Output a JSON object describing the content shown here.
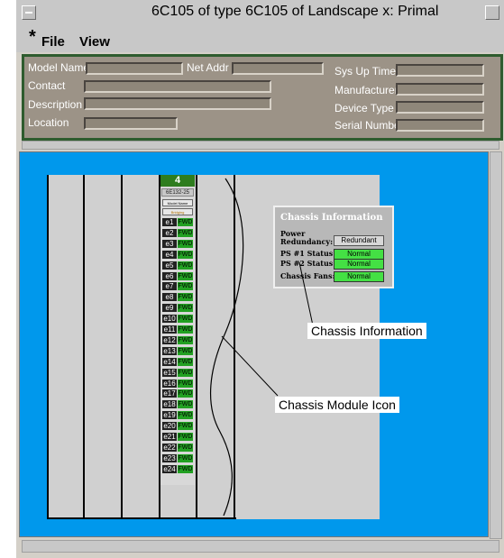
{
  "window": {
    "title": "6C105 of type 6C105 of Landscape x: Primal"
  },
  "menubar": {
    "modified_marker": "*",
    "file": "File",
    "view": "View"
  },
  "device_info": {
    "model_name_label": "Model Name",
    "net_addr_label": "Net Addr",
    "sys_up_time_label": "Sys Up Time",
    "contact_label": "Contact",
    "manufacturer_label": "Manufacturer",
    "description_label": "Description",
    "device_type_label": "Device Type",
    "location_label": "Location",
    "serial_number_label": "Serial Number"
  },
  "module": {
    "slot_number": "4",
    "type": "6E132-25",
    "name": "Model Name",
    "mode": "Bridging",
    "ports": [
      {
        "label": "e1",
        "status": "FWD"
      },
      {
        "label": "e2",
        "status": "FWD"
      },
      {
        "label": "e3",
        "status": "FWD"
      },
      {
        "label": "e4",
        "status": "FWD"
      },
      {
        "label": "e5",
        "status": "FWD"
      },
      {
        "label": "e6",
        "status": "FWD"
      },
      {
        "label": "e7",
        "status": "FWD"
      },
      {
        "label": "e8",
        "status": "FWD"
      },
      {
        "label": "e9",
        "status": "FWD"
      },
      {
        "label": "e10",
        "status": "FWD"
      },
      {
        "label": "e11",
        "status": "FWD"
      },
      {
        "label": "e12",
        "status": "FWD"
      },
      {
        "label": "e13",
        "status": "FWD"
      },
      {
        "label": "e14",
        "status": "FWD"
      },
      {
        "label": "e15",
        "status": "FWD"
      },
      {
        "label": "e16",
        "status": "FWD"
      },
      {
        "label": "e17",
        "status": "FWD"
      },
      {
        "label": "e18",
        "status": "FWD"
      },
      {
        "label": "e19",
        "status": "FWD"
      },
      {
        "label": "e20",
        "status": "FWD"
      },
      {
        "label": "e21",
        "status": "FWD"
      },
      {
        "label": "e22",
        "status": "FWD"
      },
      {
        "label": "e23",
        "status": "FWD"
      },
      {
        "label": "e24",
        "status": "FWD"
      }
    ]
  },
  "chassis_info": {
    "title": "Chassis Information",
    "power_redundancy_label": "Power Redundancy:",
    "power_redundancy_value": "Redundant",
    "ps1_label": "PS #1 Status:",
    "ps1_value": "Normal",
    "ps2_label": "PS #2 Status:",
    "ps2_value": "Normal",
    "fans_label": "Chassis Fans:",
    "fans_value": "Normal"
  },
  "callouts": {
    "chassis_information": "Chassis Information",
    "chassis_module_icon": "Chassis Module Icon"
  },
  "colors": {
    "canvas_bg": "#0098ec",
    "info_panel_bg": "#9c9387",
    "status_ok": "#44e044",
    "port_fwd": "#22a022"
  }
}
